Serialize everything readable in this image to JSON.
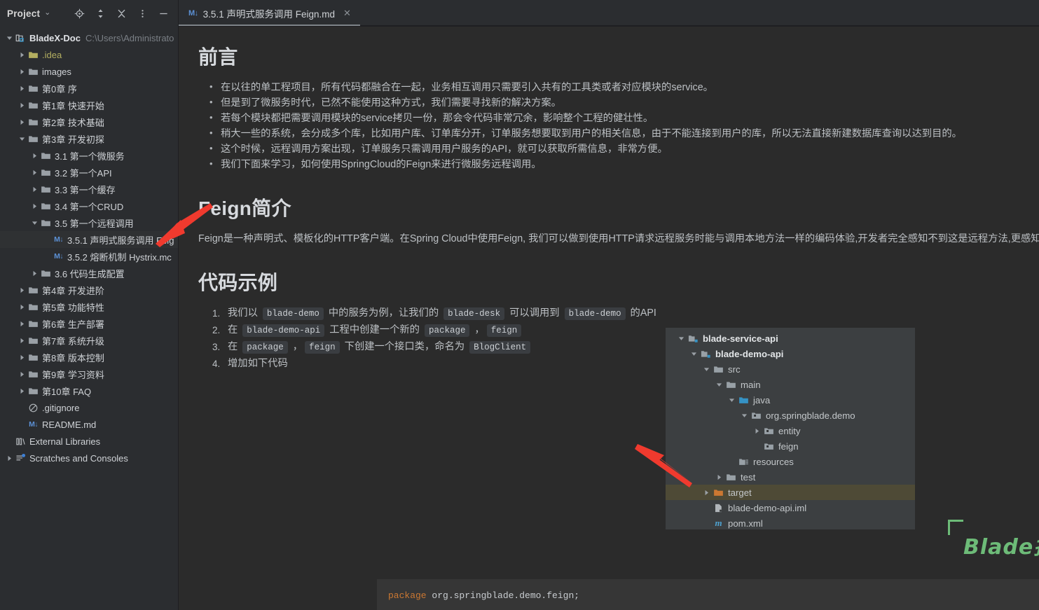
{
  "sidebar": {
    "title": "Project",
    "toolbar_icons": [
      {
        "name": "locate-icon",
        "label": "Select Opened File"
      },
      {
        "name": "expand-collapse-icon",
        "label": "Expand/Collapse"
      },
      {
        "name": "collapse-all-icon",
        "label": "Collapse All"
      },
      {
        "name": "more-options-icon",
        "label": "Options"
      },
      {
        "name": "minimize-icon",
        "label": "Hide"
      }
    ],
    "tree": [
      {
        "depth": 0,
        "twisty": "open",
        "icon": "project-module-icon",
        "label": "BladeX-Doc",
        "bold": true,
        "path": "C:\\Users\\Administrato"
      },
      {
        "depth": 1,
        "twisty": "closed",
        "icon": "folder-icon",
        "label": ".idea",
        "color": "#b3ae60"
      },
      {
        "depth": 1,
        "twisty": "closed",
        "icon": "folder-icon",
        "label": "images"
      },
      {
        "depth": 1,
        "twisty": "closed",
        "icon": "folder-icon",
        "label": "第0章 序"
      },
      {
        "depth": 1,
        "twisty": "closed",
        "icon": "folder-icon",
        "label": "第1章 快速开始"
      },
      {
        "depth": 1,
        "twisty": "closed",
        "icon": "folder-icon",
        "label": "第2章 技术基础"
      },
      {
        "depth": 1,
        "twisty": "open",
        "icon": "folder-icon",
        "label": "第3章 开发初探"
      },
      {
        "depth": 2,
        "twisty": "closed",
        "icon": "folder-icon",
        "label": "3.1 第一个微服务"
      },
      {
        "depth": 2,
        "twisty": "closed",
        "icon": "folder-icon",
        "label": "3.2 第一个API"
      },
      {
        "depth": 2,
        "twisty": "closed",
        "icon": "folder-icon",
        "label": "3.3 第一个缓存"
      },
      {
        "depth": 2,
        "twisty": "closed",
        "icon": "folder-icon",
        "label": "3.4 第一个CRUD"
      },
      {
        "depth": 2,
        "twisty": "open",
        "icon": "folder-icon",
        "label": "3.5 第一个远程调用"
      },
      {
        "depth": 3,
        "twisty": "none",
        "icon": "markdown-icon",
        "label": "3.5.1 声明式服务调用 Feig",
        "selected": true
      },
      {
        "depth": 3,
        "twisty": "none",
        "icon": "markdown-icon",
        "label": "3.5.2 熔断机制 Hystrix.mc"
      },
      {
        "depth": 2,
        "twisty": "closed",
        "icon": "folder-icon",
        "label": "3.6 代码生成配置"
      },
      {
        "depth": 1,
        "twisty": "closed",
        "icon": "folder-icon",
        "label": "第4章 开发进阶"
      },
      {
        "depth": 1,
        "twisty": "closed",
        "icon": "folder-icon",
        "label": "第5章 功能特性"
      },
      {
        "depth": 1,
        "twisty": "closed",
        "icon": "folder-icon",
        "label": "第6章 生产部署"
      },
      {
        "depth": 1,
        "twisty": "closed",
        "icon": "folder-icon",
        "label": "第7章 系统升级"
      },
      {
        "depth": 1,
        "twisty": "closed",
        "icon": "folder-icon",
        "label": "第8章 版本控制"
      },
      {
        "depth": 1,
        "twisty": "closed",
        "icon": "folder-icon",
        "label": "第9章 学习资料"
      },
      {
        "depth": 1,
        "twisty": "closed",
        "icon": "folder-icon",
        "label": "第10章 FAQ"
      },
      {
        "depth": 1,
        "twisty": "none",
        "icon": "gitignore-icon",
        "label": ".gitignore"
      },
      {
        "depth": 1,
        "twisty": "none",
        "icon": "markdown-icon",
        "label": "README.md"
      },
      {
        "depth": 0,
        "twisty": "none",
        "icon": "library-icon",
        "label": "External Libraries"
      },
      {
        "depth": 0,
        "twisty": "closed",
        "icon": "scratches-icon",
        "label": "Scratches and Consoles"
      }
    ]
  },
  "tabs": [
    {
      "badge": "M↓",
      "label": "3.5.1 声明式服务调用 Feign.md",
      "close": "✕",
      "active": true
    }
  ],
  "document": {
    "heading_1": "前言",
    "bullets": [
      "在以往的单工程项目，所有代码都融合在一起，业务相互调用只需要引入共有的工具类或者对应模块的service。",
      "但是到了微服务时代，已然不能使用这种方式，我们需要寻找新的解决方案。",
      "若每个模块都把需要调用模块的service拷贝一份，那会令代码非常冗余，影响整个工程的健壮性。",
      "稍大一些的系统，会分成多个库，比如用户库、订单库分开，订单服务想要取到用户的相关信息，由于不能连接到用户的库，所以无法直接新建数据库查询以达到目的。",
      "这个时候，远程调用方案出现，订单服务只需调用用户服务的API，就可以获取所需信息，非常方便。",
      "我们下面来学习，如何使用SpringCloud的Feign来进行微服务远程调用。"
    ],
    "heading_2": "Feign简介",
    "intro_paragraph": "Feign是一种声明式、模板化的HTTP客户端。在Spring Cloud中使用Feign, 我们可以做到使用HTTP请求远程服务时能与调用本地方法一样的编码体验,开发者完全感知不到这是远程方法,更感知不到",
    "heading_3": "代码示例",
    "steps": [
      {
        "num": 1,
        "parts": [
          {
            "t": "text",
            "v": "我们以 "
          },
          {
            "t": "code",
            "v": "blade-demo"
          },
          {
            "t": "text",
            "v": " 中的服务为例，让我们的 "
          },
          {
            "t": "code",
            "v": "blade-desk"
          },
          {
            "t": "text",
            "v": " 可以调用到 "
          },
          {
            "t": "code",
            "v": "blade-demo"
          },
          {
            "t": "text",
            "v": " 的API"
          }
        ]
      },
      {
        "num": 2,
        "parts": [
          {
            "t": "text",
            "v": "在 "
          },
          {
            "t": "code",
            "v": "blade-demo-api"
          },
          {
            "t": "text",
            "v": " 工程中创建一个新的 "
          },
          {
            "t": "code",
            "v": "package"
          },
          {
            "t": "text",
            "v": " ，"
          },
          {
            "t": "code",
            "v": "feign"
          }
        ]
      },
      {
        "num": 3,
        "parts": [
          {
            "t": "text",
            "v": "在 "
          },
          {
            "t": "code",
            "v": "package"
          },
          {
            "t": "text",
            "v": " ，"
          },
          {
            "t": "code",
            "v": "feign"
          },
          {
            "t": "text",
            "v": " 下创建一个接口类，命名为 "
          },
          {
            "t": "code",
            "v": "BlogClient"
          }
        ]
      },
      {
        "num": 4,
        "parts": [
          {
            "t": "text",
            "v": "增加如下代码"
          }
        ]
      }
    ],
    "code_block": {
      "keyword": "package",
      "rest": " org.springblade.demo.feign;"
    }
  },
  "embedded_tree": [
    {
      "depth": 0,
      "twisty": "open",
      "icon": "module-icon",
      "label": "blade-service-api",
      "bold": true
    },
    {
      "depth": 1,
      "twisty": "open",
      "icon": "module-icon",
      "label": "blade-demo-api",
      "bold": true
    },
    {
      "depth": 2,
      "twisty": "open",
      "icon": "folder-icon",
      "label": "src"
    },
    {
      "depth": 3,
      "twisty": "open",
      "icon": "folder-icon",
      "label": "main"
    },
    {
      "depth": 4,
      "twisty": "open",
      "icon": "source-root-icon",
      "label": "java"
    },
    {
      "depth": 5,
      "twisty": "open",
      "icon": "package-icon",
      "label": "org.springblade.demo"
    },
    {
      "depth": 6,
      "twisty": "closed",
      "icon": "package-icon",
      "label": "entity"
    },
    {
      "depth": 6,
      "twisty": "none",
      "icon": "package-icon",
      "label": "feign"
    },
    {
      "depth": 4,
      "twisty": "none",
      "icon": "resources-icon",
      "label": "resources"
    },
    {
      "depth": 3,
      "twisty": "closed",
      "icon": "folder-icon",
      "label": "test"
    },
    {
      "depth": 2,
      "twisty": "closed",
      "icon": "target-folder-icon",
      "label": "target",
      "highlight": true
    },
    {
      "depth": 2,
      "twisty": "none",
      "icon": "iml-file-icon",
      "label": "blade-demo-api.iml"
    },
    {
      "depth": 2,
      "twisty": "none",
      "icon": "maven-icon",
      "label": "pom.xml"
    }
  ],
  "watermark": {
    "text": "Blade技术社区",
    "color": "#6dbb78"
  },
  "annotations": [
    {
      "name": "red-arrow-to-selected-file",
      "color": "#f03a2e"
    },
    {
      "name": "red-arrow-to-feign-package",
      "color": "#f03a2e"
    }
  ],
  "colors": {
    "editor_bg": "#2b2b2b",
    "sidebar_bg": "#2b2d30",
    "selection_bg": "#2f3133",
    "accent_blue": "#5c91d6",
    "folder_gray": "#9aa0a6",
    "source_blue": "#3592c4",
    "target_orange": "#cc7832",
    "highlight_row": "#4e4a36",
    "annotation_red": "#f03a2e",
    "watermark_green": "#6dbb78"
  }
}
